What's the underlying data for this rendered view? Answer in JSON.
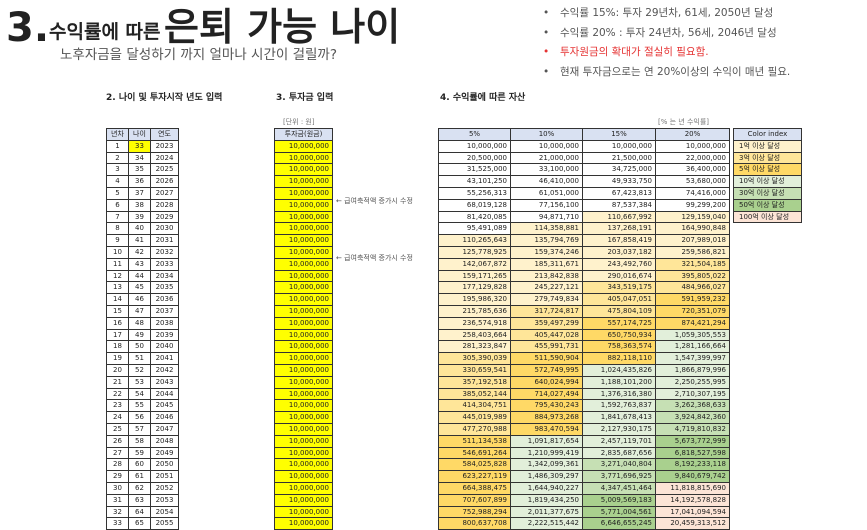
{
  "title": {
    "number": "3.",
    "part1": "수익률에 따른",
    "part2": "은퇴 가능 나이"
  },
  "subtitle": "노후자금을 달성하기 까지 얼마나 시간이 걸릴까?",
  "notes": [
    {
      "bullet": "•",
      "text": "수익률 15%: 투자 29년차, 61세, 2050년 달성"
    },
    {
      "bullet": "•",
      "text": "수익률 20% : 투자 24년차, 56세, 2046년 달성"
    },
    {
      "bullet": "•",
      "text": "투자원금의 확대가 절실히 필요함."
    },
    {
      "bullet": "•",
      "text": "현재 투자금으로는 연 20%이상의 수익이 매년 필요."
    }
  ],
  "sections": {
    "s2": "2. 나이 및 투자시작 년도 입력",
    "s3": "3. 투자금 입력",
    "s4": "4. 수익률에 따른 자산"
  },
  "units": {
    "invest": "[단위 : 원]",
    "rate": "[% 는 년 수익률]"
  },
  "year_table": {
    "headers": [
      "년차",
      "나이",
      "연도"
    ],
    "rows": [
      [
        "1",
        "33",
        "2023"
      ],
      [
        "2",
        "34",
        "2024"
      ],
      [
        "3",
        "35",
        "2025"
      ],
      [
        "4",
        "36",
        "2026"
      ],
      [
        "5",
        "37",
        "2027"
      ],
      [
        "6",
        "38",
        "2028"
      ],
      [
        "7",
        "39",
        "2029"
      ],
      [
        "8",
        "40",
        "2030"
      ],
      [
        "9",
        "41",
        "2031"
      ],
      [
        "10",
        "42",
        "2032"
      ],
      [
        "11",
        "43",
        "2033"
      ],
      [
        "12",
        "44",
        "2034"
      ],
      [
        "13",
        "45",
        "2035"
      ],
      [
        "14",
        "46",
        "2036"
      ],
      [
        "15",
        "47",
        "2037"
      ],
      [
        "16",
        "48",
        "2038"
      ],
      [
        "17",
        "49",
        "2039"
      ],
      [
        "18",
        "50",
        "2040"
      ],
      [
        "19",
        "51",
        "2041"
      ],
      [
        "20",
        "52",
        "2042"
      ],
      [
        "21",
        "53",
        "2043"
      ],
      [
        "22",
        "54",
        "2044"
      ],
      [
        "23",
        "55",
        "2045"
      ],
      [
        "24",
        "56",
        "2046"
      ],
      [
        "25",
        "57",
        "2047"
      ],
      [
        "26",
        "58",
        "2048"
      ],
      [
        "27",
        "59",
        "2049"
      ],
      [
        "28",
        "60",
        "2050"
      ],
      [
        "29",
        "61",
        "2051"
      ],
      [
        "30",
        "62",
        "2052"
      ],
      [
        "31",
        "63",
        "2053"
      ],
      [
        "32",
        "64",
        "2054"
      ],
      [
        "33",
        "65",
        "2055"
      ]
    ]
  },
  "invest_table": {
    "header": "투자금(원금)",
    "rows": [
      "10,000,000",
      "10,000,000",
      "10,000,000",
      "10,000,000",
      "10,000,000",
      "10,000,000",
      "10,000,000",
      "10,000,000",
      "10,000,000",
      "10,000,000",
      "10,000,000",
      "10,000,000",
      "10,000,000",
      "10,000,000",
      "10,000,000",
      "10,000,000",
      "10,000,000",
      "10,000,000",
      "10,000,000",
      "10,000,000",
      "10,000,000",
      "10,000,000",
      "10,000,000",
      "10,000,000",
      "10,000,000",
      "10,000,000",
      "10,000,000",
      "10,000,000",
      "10,000,000",
      "10,000,000",
      "10,000,000",
      "10,000,000",
      "10,000,000"
    ]
  },
  "memos": {
    "m1": "← 급여축적액 증가시 수정",
    "m2": "← 급여축적액 증가시 수정"
  },
  "return_table": {
    "headers": [
      "5%",
      "10%",
      "15%",
      "20%"
    ],
    "rows": [
      [
        "10,000,000",
        "10,000,000",
        "10,000,000",
        "10,000,000"
      ],
      [
        "20,500,000",
        "21,000,000",
        "21,500,000",
        "22,000,000"
      ],
      [
        "31,525,000",
        "33,100,000",
        "34,725,000",
        "36,400,000"
      ],
      [
        "43,101,250",
        "46,410,000",
        "49,933,750",
        "53,680,000"
      ],
      [
        "55,256,313",
        "61,051,000",
        "67,423,813",
        "74,416,000"
      ],
      [
        "68,019,128",
        "77,156,100",
        "87,537,384",
        "99,299,200"
      ],
      [
        "81,420,085",
        "94,871,710",
        "110,667,992",
        "129,159,040"
      ],
      [
        "95,491,089",
        "114,358,881",
        "137,268,191",
        "164,990,848"
      ],
      [
        "110,265,643",
        "135,794,769",
        "167,858,419",
        "207,989,018"
      ],
      [
        "125,778,925",
        "159,374,246",
        "203,037,182",
        "259,586,821"
      ],
      [
        "142,067,872",
        "185,311,671",
        "243,492,760",
        "321,504,185"
      ],
      [
        "159,171,265",
        "213,842,838",
        "290,016,674",
        "395,805,022"
      ],
      [
        "177,129,828",
        "245,227,121",
        "343,519,175",
        "484,966,027"
      ],
      [
        "195,986,320",
        "279,749,834",
        "405,047,051",
        "591,959,232"
      ],
      [
        "215,785,636",
        "317,724,817",
        "475,804,109",
        "720,351,079"
      ],
      [
        "236,574,918",
        "359,497,299",
        "557,174,725",
        "874,421,294"
      ],
      [
        "258,403,664",
        "405,447,028",
        "650,750,934",
        "1,059,305,553"
      ],
      [
        "281,323,847",
        "455,991,731",
        "758,363,574",
        "1,281,166,664"
      ],
      [
        "305,390,039",
        "511,590,904",
        "882,118,110",
        "1,547,399,997"
      ],
      [
        "330,659,541",
        "572,749,995",
        "1,024,435,826",
        "1,866,879,996"
      ],
      [
        "357,192,518",
        "640,024,994",
        "1,188,101,200",
        "2,250,255,995"
      ],
      [
        "385,052,144",
        "714,027,494",
        "1,376,316,380",
        "2,710,307,195"
      ],
      [
        "414,304,751",
        "795,430,243",
        "1,592,763,837",
        "3,262,368,633"
      ],
      [
        "445,019,989",
        "884,973,268",
        "1,841,678,413",
        "3,924,842,360"
      ],
      [
        "477,270,988",
        "983,470,594",
        "2,127,930,175",
        "4,719,810,832"
      ],
      [
        "511,134,538",
        "1,091,817,654",
        "2,457,119,701",
        "5,673,772,999"
      ],
      [
        "546,691,264",
        "1,210,999,419",
        "2,835,687,656",
        "6,818,527,598"
      ],
      [
        "584,025,828",
        "1,342,099,361",
        "3,271,040,804",
        "8,192,233,118"
      ],
      [
        "623,227,119",
        "1,486,309,297",
        "3,771,696,925",
        "9,840,679,742"
      ],
      [
        "664,388,475",
        "1,644,940,227",
        "4,347,451,464",
        "11,818,815,690"
      ],
      [
        "707,607,899",
        "1,819,434,250",
        "5,009,569,183",
        "14,192,578,828"
      ],
      [
        "752,988,294",
        "2,011,377,675",
        "5,771,004,561",
        "17,041,094,594"
      ],
      [
        "800,637,708",
        "2,222,515,442",
        "6,646,655,245",
        "20,459,313,512"
      ]
    ]
  },
  "color_index": {
    "header": "Color index",
    "items": [
      {
        "label": "1억 이상 달성",
        "color": "#fff2cc"
      },
      {
        "label": "3억 이상 달성",
        "color": "#ffe699"
      },
      {
        "label": "5억 이상 달성",
        "color": "#ffd966"
      },
      {
        "label": "10억 이상 달성",
        "color": "#e2efda"
      },
      {
        "label": "30억 이상 달성",
        "color": "#c6e0b4"
      },
      {
        "label": "50억 이상 달성",
        "color": "#a9d08e"
      },
      {
        "label": "100억 이상 달성",
        "color": "#fce4d6"
      }
    ]
  }
}
